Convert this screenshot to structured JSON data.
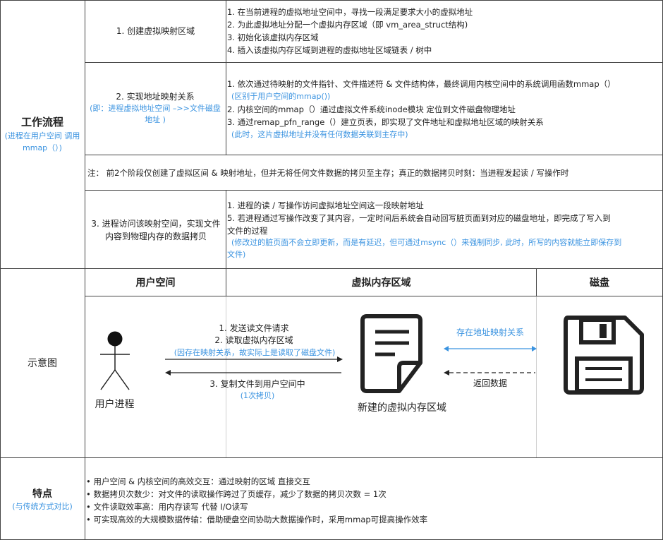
{
  "workflow": {
    "title": "工作流程",
    "subtitle": "(进程在用户空间 调用mmap（）)",
    "step1": {
      "label": "1. 创建虚拟映射区域",
      "lines": [
        "1. 在当前进程的虚拟地址空间中，寻找一段满足要求大小的虚拟地址",
        "2. 为此虚拟地址分配一个虚拟内存区域（即 vm_area_struct结构)",
        "3. 初始化该虚拟内存区域",
        "4. 插入该虚拟内存区域到进程的虚拟地址区域链表 / 树中"
      ]
    },
    "step2": {
      "label": "2. 实现地址映射关系",
      "note": "(即：进程虚拟地址空间 –>>文件磁盘地址 )",
      "lines": [
        "1. 依次通过待映射的文件指针、文件描述符 & 文件结构体，最终调用内核空间中的系统调用函数mmap（）",
        "(区别于用户空间的mmap())",
        "2. 内核空间的mmap（）通过虚拟文件系统inode模块 定位到文件磁盘物理地址",
        "3. 通过remap_pfn_range（）建立页表，即实现了文件地址和虚拟地址区域的映射关系",
        "(此时，这片虚拟地址并没有任何数据关联到主存中)"
      ]
    },
    "note": "注：  前2个阶段仅创建了虚拟区间 & 映射地址，但并无将任何文件数据的拷贝至主存；真正的数据拷贝时刻：当进程发起读 / 写操作时",
    "step3": {
      "label": "3. 进程访问该映射空间，实现文件内容到物理内存的数据拷贝",
      "lines": [
        "1. 进程的读 / 写操作访问虚拟地址空间这一段映射地址",
        "5. 若进程通过写操作改变了其内容，一定时间后系统会自动回写脏页面到对应的磁盘地址，即完成了写入到",
        "文件的过程",
        "(修改过的脏页面不会立即更新，而是有延迟，但可通过msync（）来强制同步, 此时，所写的内容就能立即保存到",
        "文件)"
      ]
    }
  },
  "diagram": {
    "title": "示意图",
    "headers": {
      "user": "用户空间",
      "vma": "虚拟内存区域",
      "disk": "磁盘"
    },
    "user_process_label": "用户进程",
    "vma_label": "新建的虚拟内存区域",
    "arrow_request": {
      "line1": "1. 发送读文件请求",
      "line2": "2. 读取虚拟内存区域",
      "note": "(因存在映射关系，故实际上是读取了磁盘文件)"
    },
    "arrow_copy": {
      "label": "3. 复制文件到用户空间中",
      "note": "(1次拷贝)"
    },
    "mapping_label": "存在地址映射关系",
    "return_label": "返回数据"
  },
  "features": {
    "title": "特点",
    "subtitle": "(与传统方式对比)",
    "items": [
      "• 用户空间 & 内核空间的高效交互：通过映射的区域 直接交互",
      "• 数据拷贝次数少：对文件的读取操作跨过了页缓存，减少了数据的拷贝次数 = 1次",
      "• 文件读取效率高：用内存读写 代替 I/O读写",
      "• 可实现高效的大规模数据传输：借助硬盘空间协助大数据操作时，采用mmap可提高操作效率"
    ]
  },
  "colors": {
    "accent_blue": "#3a93e0",
    "border": "#444444"
  }
}
